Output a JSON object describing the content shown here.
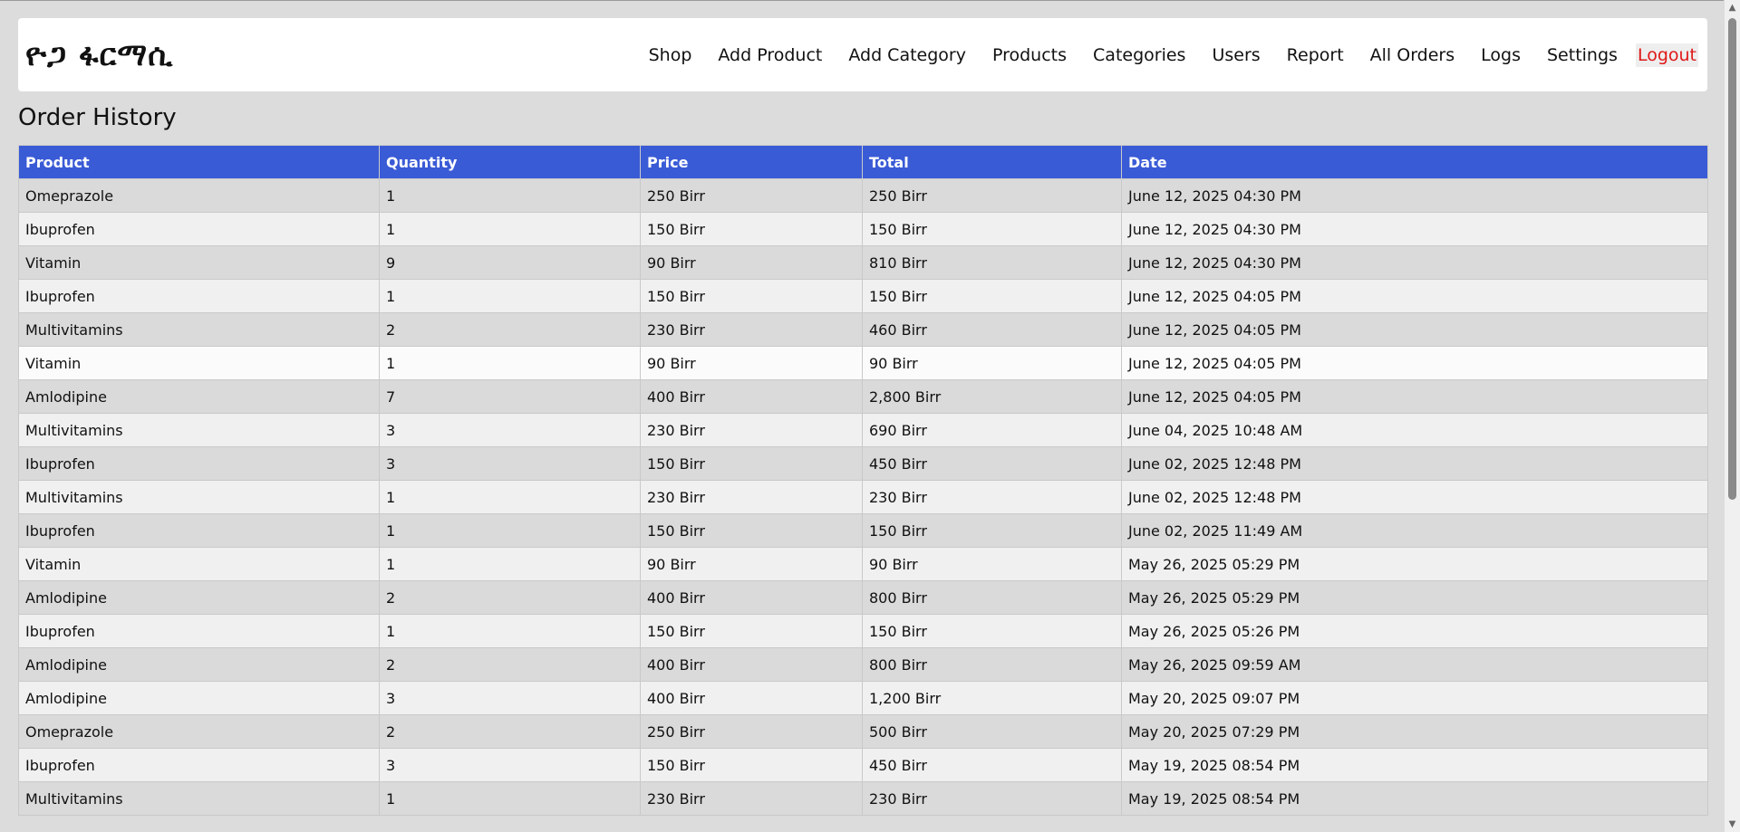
{
  "brand": {
    "name": "ዮጋ ፋርማሲ"
  },
  "nav": {
    "items": [
      {
        "label": "Shop"
      },
      {
        "label": "Add Product"
      },
      {
        "label": "Add Category"
      },
      {
        "label": "Products"
      },
      {
        "label": "Categories"
      },
      {
        "label": "Users"
      },
      {
        "label": "Report"
      },
      {
        "label": "All Orders"
      },
      {
        "label": "Logs"
      },
      {
        "label": "Settings"
      }
    ],
    "logout": "Logout"
  },
  "page": {
    "title": "Order History"
  },
  "table": {
    "headers": [
      "Product",
      "Quantity",
      "Price",
      "Total",
      "Date"
    ],
    "rows": [
      [
        "Omeprazole",
        "1",
        "250 Birr",
        "250 Birr",
        "June 12, 2025 04:30 PM"
      ],
      [
        "Ibuprofen",
        "1",
        "150 Birr",
        "150 Birr",
        "June 12, 2025 04:30 PM"
      ],
      [
        "Vitamin",
        "9",
        "90 Birr",
        "810 Birr",
        "June 12, 2025 04:30 PM"
      ],
      [
        "Ibuprofen",
        "1",
        "150 Birr",
        "150 Birr",
        "June 12, 2025 04:05 PM"
      ],
      [
        "Multivitamins",
        "2",
        "230 Birr",
        "460 Birr",
        "June 12, 2025 04:05 PM"
      ],
      [
        "Vitamin",
        "1",
        "90 Birr",
        "90 Birr",
        "June 12, 2025 04:05 PM"
      ],
      [
        "Amlodipine",
        "7",
        "400 Birr",
        "2,800 Birr",
        "June 12, 2025 04:05 PM"
      ],
      [
        "Multivitamins",
        "3",
        "230 Birr",
        "690 Birr",
        "June 04, 2025 10:48 AM"
      ],
      [
        "Ibuprofen",
        "3",
        "150 Birr",
        "450 Birr",
        "June 02, 2025 12:48 PM"
      ],
      [
        "Multivitamins",
        "1",
        "230 Birr",
        "230 Birr",
        "June 02, 2025 12:48 PM"
      ],
      [
        "Ibuprofen",
        "1",
        "150 Birr",
        "150 Birr",
        "June 02, 2025 11:49 AM"
      ],
      [
        "Vitamin",
        "1",
        "90 Birr",
        "90 Birr",
        "May 26, 2025 05:29 PM"
      ],
      [
        "Amlodipine",
        "2",
        "400 Birr",
        "800 Birr",
        "May 26, 2025 05:29 PM"
      ],
      [
        "Ibuprofen",
        "1",
        "150 Birr",
        "150 Birr",
        "May 26, 2025 05:26 PM"
      ],
      [
        "Amlodipine",
        "2",
        "400 Birr",
        "800 Birr",
        "May 26, 2025 09:59 AM"
      ],
      [
        "Amlodipine",
        "3",
        "400 Birr",
        "1,200 Birr",
        "May 20, 2025 09:07 PM"
      ],
      [
        "Omeprazole",
        "2",
        "250 Birr",
        "500 Birr",
        "May 20, 2025 07:29 PM"
      ],
      [
        "Ibuprofen",
        "3",
        "150 Birr",
        "450 Birr",
        "May 19, 2025 08:54 PM"
      ],
      [
        "Multivitamins",
        "1",
        "230 Birr",
        "230 Birr",
        "May 19, 2025 08:54 PM"
      ]
    ]
  },
  "colors": {
    "header_bg": "#3a5bd6",
    "logout": "#e01818",
    "page_bg": "#dcdcdc"
  }
}
